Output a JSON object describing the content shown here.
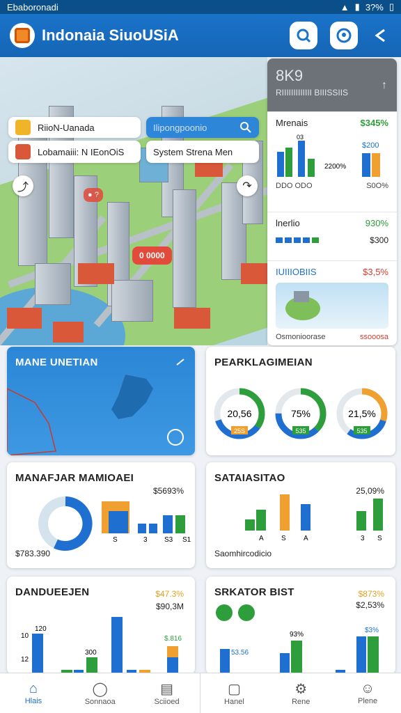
{
  "status": {
    "left": "Ebaboronadi",
    "right": "3?%"
  },
  "app": {
    "title": "Indonaia SiuoUSiA",
    "colors": {
      "primary": "#1a73c9",
      "accent": "#f08a24"
    }
  },
  "map": {
    "chip1": "RiioN-Uanada",
    "chip2": "Lobamaiii: N IEonOiS",
    "search": "Ilipongpoonio",
    "system": "System Strena Men",
    "pin": "0 0000"
  },
  "panel": {
    "header_big": "8K9",
    "header_sub": "RIIIIIIIIIIIII BIIISSIIS",
    "sec1_label": "Mrenais",
    "sec1_value": "$345%",
    "sec1_left_num": "03",
    "sec1_right_val": "$200",
    "sec1_mid": "2200%",
    "sec1_foot_left": "DDO   ODO",
    "sec1_foot_right": "S0O%",
    "sec2_label": "lnerlio",
    "sec2_value": "930%",
    "sec2_money": "$300",
    "sec3_label": "IUIIIOBIIS",
    "sec3_value": "$3,5%",
    "footer_left": "Osmonioorase",
    "footer_right": "ssooosa"
  },
  "cards": {
    "map_card": {
      "title": "MANE UNETIAN"
    },
    "donuts": {
      "title": "PEARKLAGIMEIAN",
      "items": [
        {
          "value": "20,56",
          "badge": "25S",
          "pct": 0.7
        },
        {
          "value": "75%",
          "badge": "535",
          "pct": 0.75
        },
        {
          "value": "21,5%",
          "badge": "535",
          "pct": 0.6
        }
      ]
    },
    "manafar": {
      "title": "MANAFJAR MAMIOAEI",
      "value": "$5693%",
      "foot": "$783.390",
      "ticks": [
        "S",
        "3",
        "S3",
        "S1"
      ]
    },
    "satai": {
      "title": "SATAIASITAO",
      "value": "25,09%",
      "foot": "Saomhircodicio",
      "ticks": [
        "A",
        "S",
        "A",
        "3",
        "S"
      ]
    },
    "nano": {
      "title": "DANDUEEJEN",
      "v1": "$47.3%",
      "v2": "$90,3M",
      "labels": [
        "120",
        "10",
        "12",
        "300",
        "$.816"
      ]
    },
    "skator": {
      "title": "SRKATOR BIST",
      "v1": "$873%",
      "v2": "$2,53%",
      "labels": [
        "93%",
        "$3%",
        "53.56"
      ]
    }
  },
  "nav": {
    "items": [
      "Hlais",
      "Sonnaoa",
      "Sciioed",
      "Hanel",
      "Rene",
      "Plene"
    ]
  }
}
